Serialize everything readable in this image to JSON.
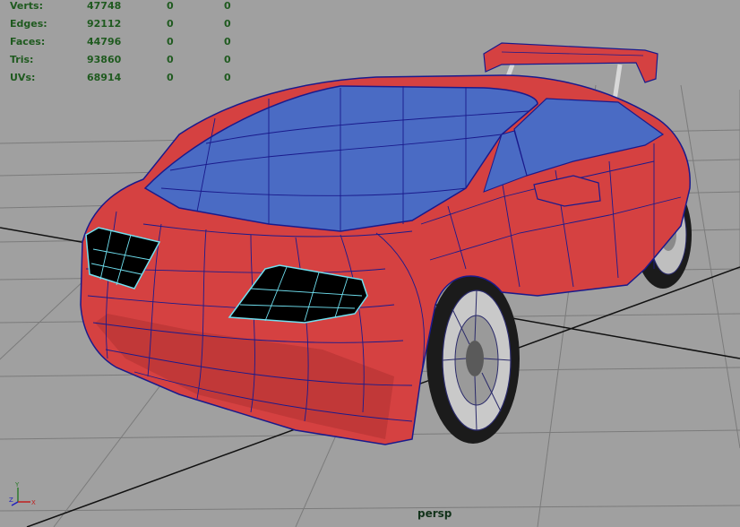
{
  "hud": {
    "rows": [
      {
        "label": "Verts:",
        "values": [
          "47748",
          "0",
          "0"
        ]
      },
      {
        "label": "Edges:",
        "values": [
          "92112",
          "0",
          "0"
        ]
      },
      {
        "label": "Faces:",
        "values": [
          "44796",
          "0",
          "0"
        ]
      },
      {
        "label": "Tris:",
        "values": [
          "93860",
          "0",
          "0"
        ]
      },
      {
        "label": "UVs:",
        "values": [
          "68914",
          "0",
          "0"
        ]
      }
    ]
  },
  "camera": {
    "name": "persp"
  },
  "axis_gizmo": {
    "labels": [
      "Y",
      "Z",
      "X"
    ]
  },
  "colors": {
    "background": "#a0a0a0",
    "grid": "#7b7b7b",
    "grid_main": "#000000",
    "body": "#d54141",
    "glass": "#4a6bc4",
    "wire": "#1a1a8c",
    "light_wire": "#6fe0f0",
    "hud_text": "#1f5a1f"
  }
}
